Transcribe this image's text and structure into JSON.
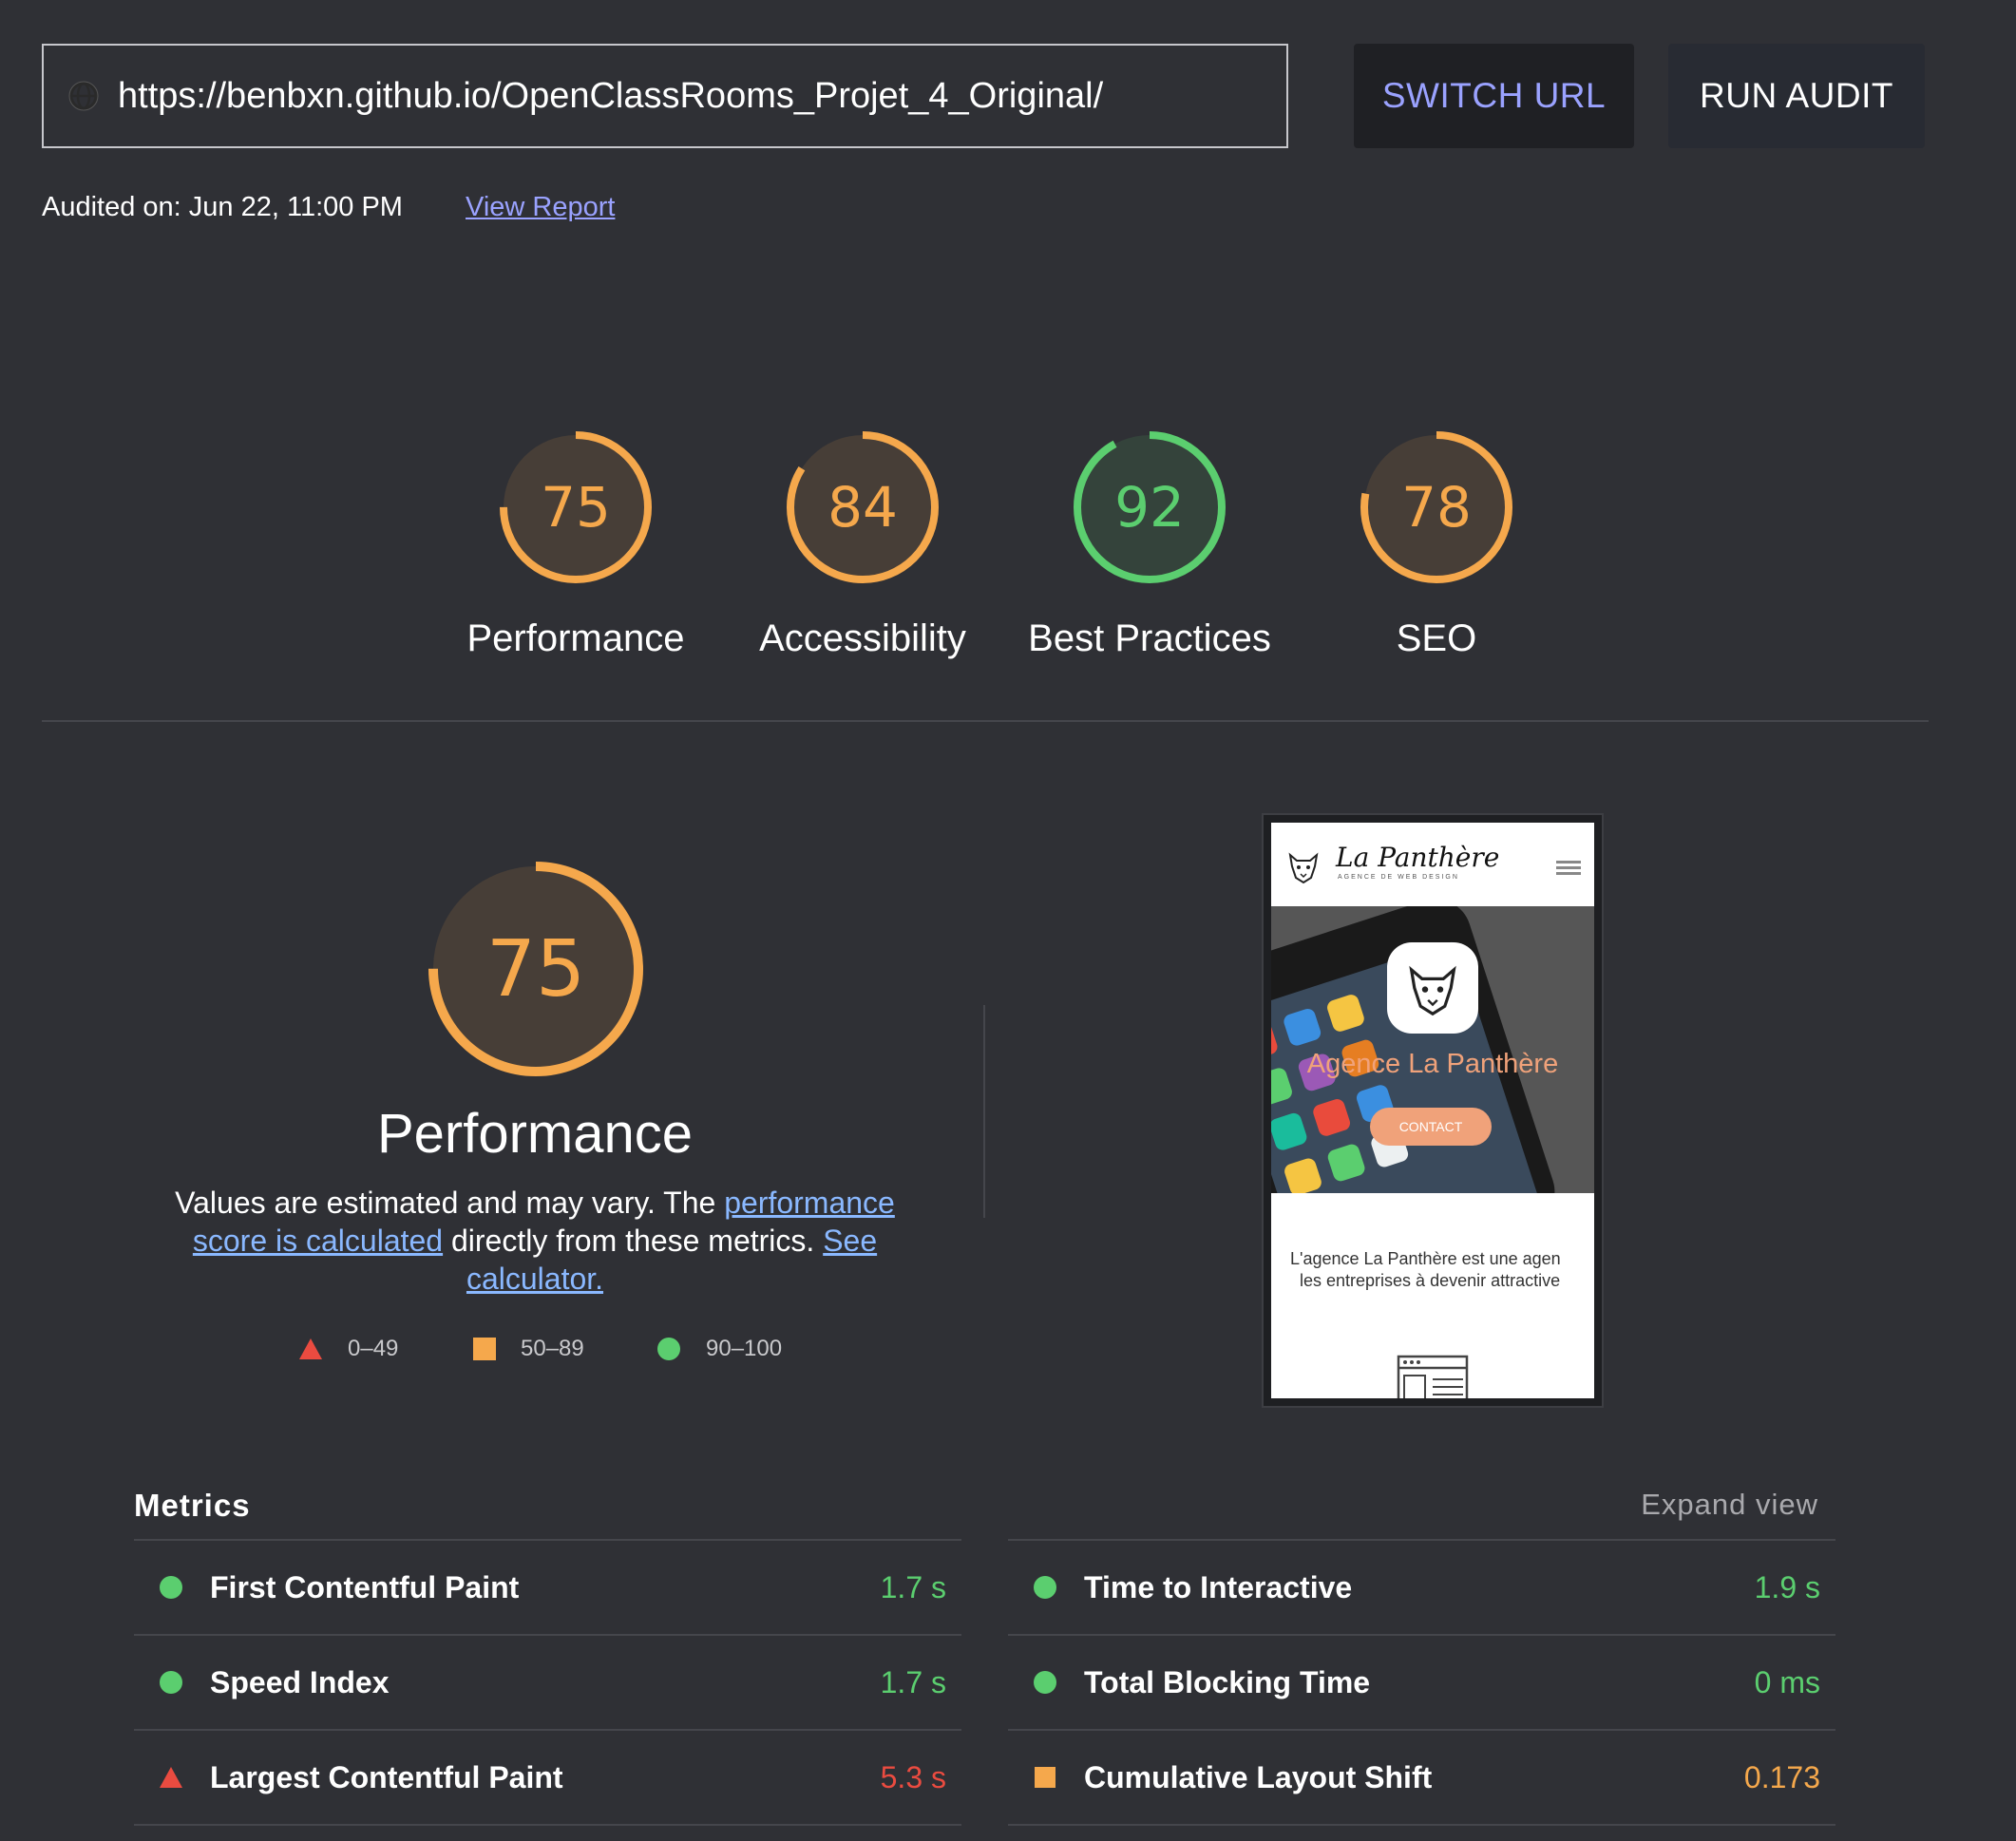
{
  "toolbar": {
    "url": "https://benbxn.github.io/OpenClassRooms_Projet_4_Original/",
    "switch_label": "SWITCH URL",
    "run_label": "RUN AUDIT",
    "audited_text": "Audited on: Jun 22, 11:00 PM",
    "view_report": "View Report"
  },
  "scores": [
    {
      "label": "Performance",
      "score": "75",
      "value": 75,
      "color": "#f5a84c"
    },
    {
      "label": "Accessibility",
      "score": "84",
      "value": 84,
      "color": "#f5a84c"
    },
    {
      "label": "Best Practices",
      "score": "92",
      "value": 92,
      "color": "#5bce6f"
    },
    {
      "label": "SEO",
      "score": "78",
      "value": 78,
      "color": "#f5a84c"
    }
  ],
  "performance": {
    "score": "75",
    "value": 75,
    "title": "Performance",
    "desc_1": "Values are estimated and may vary. The ",
    "link_1": "performance score is calculated",
    "desc_2": " directly from these metrics. ",
    "link_2": "See calculator.",
    "legend": [
      {
        "range": "0–49",
        "shape": "triangle",
        "color": "#ea4b40"
      },
      {
        "range": "50–89",
        "shape": "square",
        "color": "#f5a84c"
      },
      {
        "range": "90–100",
        "shape": "circle",
        "color": "#5bce6f"
      }
    ]
  },
  "thumbnail": {
    "brand": "La Panthère",
    "brand_sub": "AGENCE DE WEB DESIGN",
    "hero_title": "Agence La Panthère",
    "hero_button": "CONTACT",
    "line_1": "L'agence La Panthère est une agen",
    "line_2": "les entreprises à devenir attractive"
  },
  "metrics": {
    "title": "Metrics",
    "expand": "Expand view",
    "left": [
      {
        "label": "First Contentful Paint",
        "value": "1.7 s",
        "status": "green"
      },
      {
        "label": "Speed Index",
        "value": "1.7 s",
        "status": "green"
      },
      {
        "label": "Largest Contentful Paint",
        "value": "5.3 s",
        "status": "red"
      }
    ],
    "right": [
      {
        "label": "Time to Interactive",
        "value": "1.9 s",
        "status": "green"
      },
      {
        "label": "Total Blocking Time",
        "value": "0 ms",
        "status": "green"
      },
      {
        "label": "Cumulative Layout Shift",
        "value": "0.173",
        "status": "orange"
      }
    ]
  }
}
